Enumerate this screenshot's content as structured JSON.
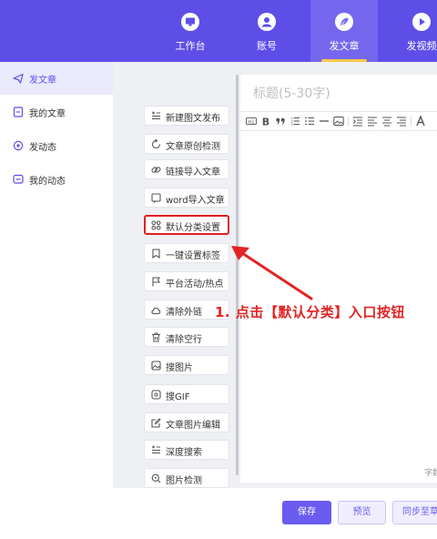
{
  "nav": {
    "items": [
      {
        "label": "工作台",
        "icon": "monitor-icon"
      },
      {
        "label": "账号",
        "icon": "user-icon"
      },
      {
        "label": "发文章",
        "icon": "feather-icon",
        "active": true
      },
      {
        "label": "发视频",
        "icon": "play-icon"
      }
    ]
  },
  "sidebar": {
    "items": [
      {
        "label": "发文章",
        "icon": "paper-plane-icon",
        "active": true
      },
      {
        "label": "我的文章",
        "icon": "document-icon"
      },
      {
        "label": "发动态",
        "icon": "target-icon"
      },
      {
        "label": "我的动态",
        "icon": "chat-icon"
      }
    ]
  },
  "tools": [
    {
      "label": "新建图文发布",
      "icon": "new-post-icon"
    },
    {
      "label": "文章原创检测",
      "icon": "refresh-icon"
    },
    {
      "label": "链接导入文章",
      "icon": "link-icon"
    },
    {
      "label": "word导入文章",
      "icon": "word-icon"
    },
    {
      "label": "默认分类设置",
      "icon": "category-icon",
      "highlight": true
    },
    {
      "label": "一键设置标签",
      "icon": "tag-icon"
    },
    {
      "label": "平台活动/热点",
      "icon": "flag-icon"
    },
    {
      "label": "清除外链",
      "icon": "unlink-icon"
    },
    {
      "label": "清除空行",
      "icon": "trash-icon"
    },
    {
      "label": "搜图片",
      "icon": "image-icon"
    },
    {
      "label": "搜GIF",
      "icon": "gif-icon"
    },
    {
      "label": "文章图片编辑",
      "icon": "edit-icon"
    },
    {
      "label": "深度搜索",
      "icon": "deep-search-icon"
    },
    {
      "label": "图片检测",
      "icon": "image-check-icon"
    }
  ],
  "editor": {
    "title_placeholder": "标题(5-30字)",
    "wordcount_label": "字数"
  },
  "toolbar": {
    "buttons": [
      "heading-icon",
      "bold-icon",
      "quote-icon",
      "ordered-list-icon",
      "bullet-list-icon",
      "hr-icon",
      "image-icon",
      "indent-icon",
      "align-left-icon",
      "align-center-icon",
      "align-right-icon",
      "font-icon"
    ]
  },
  "actions": {
    "save": "保存",
    "preview": "预览",
    "sync": "同步至草稿"
  },
  "annotation": {
    "text": "1. 点击【默认分类】入口按钮"
  },
  "colors": {
    "brand": "#5e4ee8",
    "accent": "#ffc84a",
    "annotation": "#e22424"
  }
}
